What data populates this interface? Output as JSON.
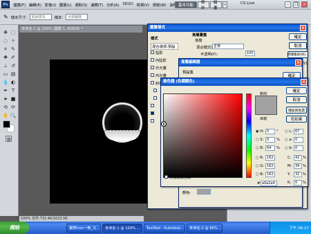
{
  "app": {
    "logo": "Ps",
    "menu": [
      "檔案(F)",
      "編輯(E)",
      "影像(I)",
      "圖層(L)",
      "選取(S)",
      "濾鏡(T)",
      "分析(A)",
      "3D(D)",
      "檢視(V)",
      "視窗(W)",
      "說明(H)"
    ],
    "zoom": "100%",
    "workspaces": {
      "active": "基本功能",
      "b2": "設計",
      "b3": "繪畫",
      "more": "»"
    },
    "cs_live": "CS Live"
  },
  "options": {
    "label1": "樣本尺寸:",
    "value1": "點狀樣本",
    "label2": "樣本:",
    "value2": "全部圖層"
  },
  "document": {
    "tab_title": "未命名-1 @ 100% (圖層 1, RGB/8) *",
    "status": "文件:732.4K/1023.5K"
  },
  "layer_style": {
    "title": "圖層樣式",
    "styles_header": "樣式",
    "blend_options": "混合選項:預設",
    "items": [
      "陰影",
      "內陰影",
      "外光暈",
      "內光暈",
      "斜角和浮雕",
      "輪廓",
      "紋理",
      "緞面",
      "顏色覆蓋",
      "漸層覆蓋",
      "圖樣覆蓋",
      "筆畫"
    ],
    "section": "漸層覆蓋",
    "sub": "漸層",
    "blend_label": "混合模式(O):",
    "blend_value": "正常",
    "opacity_label": "不透明(P):",
    "opacity_value": "100",
    "ok": "確定",
    "cancel": "取消",
    "new_style": "新增樣式(W)...",
    "preview": "預視(V)"
  },
  "gradient_editor": {
    "title": "漸層編輯器",
    "preset": "預設集",
    "ok": "確定",
    "location_label": "位置:",
    "color_label": "顏色:"
  },
  "color_picker": {
    "title": "檢色器 (色標顏色)",
    "new_label": "新的",
    "current_label": "目前",
    "ok": "確定",
    "cancel": "取消",
    "add_swatch": "增加到色票",
    "libraries": "色彩庫",
    "web_only": "只有網頁色彩",
    "hex_label": "#",
    "hex": "a0a2a4",
    "H": "0",
    "S": "0",
    "B": "64",
    "R": "162",
    "G": "162",
    "Bv": "162",
    "L": "67",
    "a": "0",
    "b": "0",
    "C": "42",
    "M": "34",
    "Y": "32",
    "K": "0",
    "H_unit": "°",
    "pct": "%",
    "new_color": "#a2a2a2",
    "current_color": "#a2a2a2"
  },
  "taskbar": {
    "start": "開始",
    "tasks": [
      "實際icon一教_又...",
      "未命名-1 @ 100% ...",
      "TextPad - Autodesk...",
      "未命名-2 @ 66% ..."
    ],
    "clock": "下午 06:27"
  }
}
